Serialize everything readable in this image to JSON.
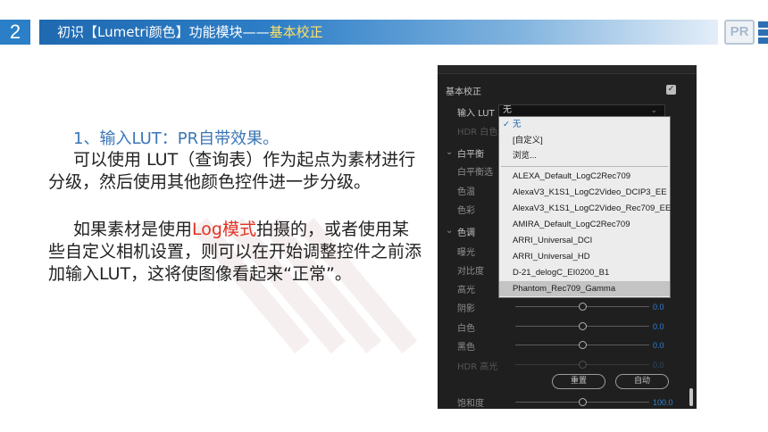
{
  "slide": {
    "number": "2",
    "title_part1": "初识【Lumetri颜色】功能模块——",
    "title_part2": "基本校正",
    "logo": "PR"
  },
  "content": {
    "heading": "1、输入LUT：PR自带效果。",
    "para1": "可以使用 LUT（查询表）作为起点为素材进行分级，然后使用其他颜色控件进一步分级。",
    "para2_before": "如果素材是使用",
    "para2_highlight": "Log模式",
    "para2_after": "拍摄的，或者使用某些自定义相机设置，则可以在开始调整控件之前添加输入LUT，这将使图像看起来“正常”。",
    "highlight_color": "#e23222"
  },
  "panel": {
    "section_title": "基本校正",
    "section_enabled": true,
    "input_lut_label": "输入 LUT",
    "input_lut_value": "无",
    "hdr_white_label": "HDR 白色",
    "white_balance_label": "白平衡",
    "wb_selector_label": "白平衡选",
    "temperature_label": "色温",
    "tint_label": "色彩",
    "tone_label": "色调",
    "exposure_label": "曝光",
    "contrast_label": "对比度",
    "highlights_label": "高光",
    "shadows_label": "阴影",
    "shadows_value": "0.0",
    "whites_label": "白色",
    "whites_value": "0.0",
    "blacks_label": "黑色",
    "blacks_value": "0.0",
    "hdr_specular_label": "HDR 高光",
    "hdr_specular_value": "0.0",
    "reset_button": "重置",
    "auto_button": "自动",
    "saturation_label": "饱和度",
    "saturation_value": "100.0",
    "dropdown": {
      "none": "无",
      "custom": "[自定义]",
      "browse": "浏览...",
      "luts": [
        "ALEXA_Default_LogC2Rec709",
        "AlexaV3_K1S1_LogC2Video_DCIP3_EE",
        "AlexaV3_K1S1_LogC2Video_Rec709_EE",
        "AMIRA_Default_LogC2Rec709",
        "ARRI_Universal_DCI",
        "ARRI_Universal_HD",
        "D-21_delogC_EI0200_B1",
        "Phantom_Rec709_Gamma"
      ]
    }
  }
}
